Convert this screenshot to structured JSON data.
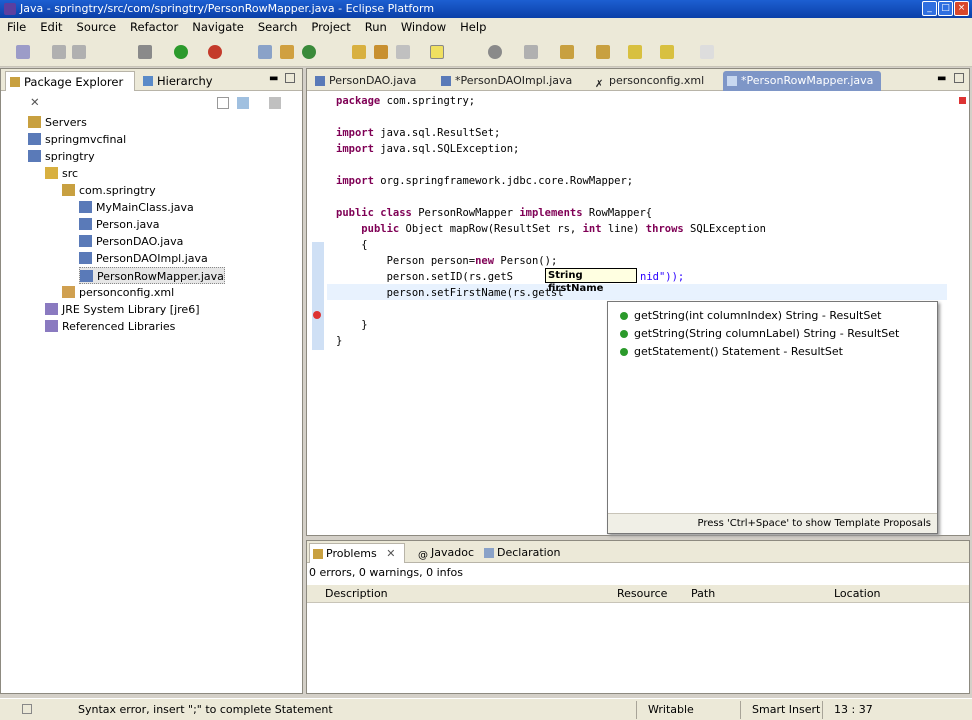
{
  "window": {
    "title": "Java - springtry/src/com/springtry/PersonRowMapper.java - Eclipse Platform"
  },
  "menu": [
    "File",
    "Edit",
    "Source",
    "Refactor",
    "Navigate",
    "Search",
    "Project",
    "Run",
    "Window",
    "Help"
  ],
  "left_panel": {
    "tabs": [
      "Package Explorer",
      "Hierarchy"
    ],
    "tree": [
      {
        "label": "Servers",
        "level": 1
      },
      {
        "label": "springmvcfinal",
        "level": 1
      },
      {
        "label": "springtry",
        "level": 1
      },
      {
        "label": "src",
        "level": 2
      },
      {
        "label": "com.springtry",
        "level": 3
      },
      {
        "label": "MyMainClass.java",
        "level": 4
      },
      {
        "label": "Person.java",
        "level": 4
      },
      {
        "label": "PersonDAO.java",
        "level": 4
      },
      {
        "label": "PersonDAOImpl.java",
        "level": 4
      },
      {
        "label": "PersonRowMapper.java",
        "level": 4
      },
      {
        "label": "personconfig.xml",
        "level": 3
      },
      {
        "label": "JRE System Library [jre6]",
        "level": 2
      },
      {
        "label": "Referenced Libraries",
        "level": 2
      }
    ]
  },
  "editor": {
    "tabs": [
      "PersonDAO.java",
      "*PersonDAOImpl.java",
      "personconfig.xml",
      "*PersonRowMapper.java"
    ],
    "lines": [
      "package com.springtry;",
      "",
      "import java.sql.ResultSet;",
      "import java.sql.SQLException;",
      "",
      "import org.springframework.jdbc.core.RowMapper;",
      "",
      "public class PersonRowMapper implements RowMapper{",
      "    public Object mapRow(ResultSet rs, int line) throws SQLException",
      "    {",
      "        Person person=new Person();",
      "        person.setID(rs.getS",
      "        person.setFirstName(rs.getst",
      "",
      "    }",
      "}"
    ],
    "line11_tail": "nid\"));",
    "tooltip": "String firstName"
  },
  "content_assist": {
    "proposals": [
      "getString(int columnIndex)  String - ResultSet",
      "getString(String columnLabel)  String - ResultSet",
      "getStatement()  Statement - ResultSet"
    ],
    "footer": "Press 'Ctrl+Space' to show Template Proposals"
  },
  "bottom_panel": {
    "tabs": [
      "Problems",
      "Javadoc",
      "Declaration"
    ],
    "summary": "0 errors, 0 warnings, 0 infos",
    "columns": [
      "Description",
      "Resource",
      "Path",
      "Location"
    ]
  },
  "status": {
    "message": "Syntax error, insert \";\" to complete Statement",
    "writable": "Writable",
    "insert_mode": "Smart Insert",
    "position": "13 : 37"
  }
}
